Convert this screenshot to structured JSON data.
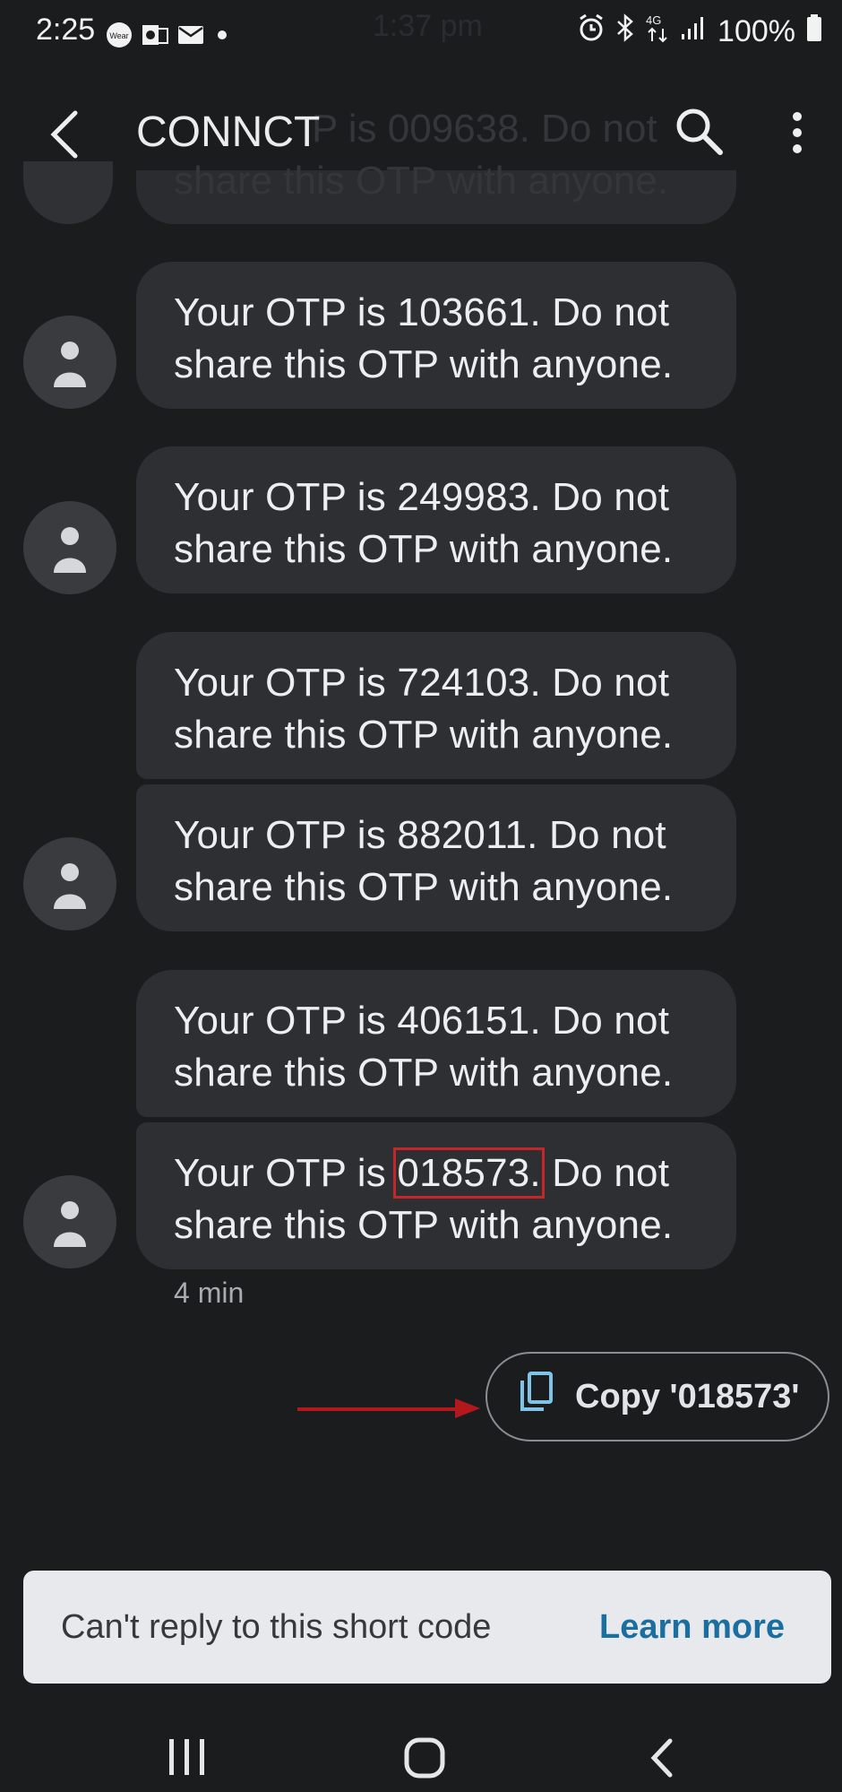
{
  "status_bar": {
    "time": "2:25",
    "left_icons": [
      "wear-os-icon",
      "outlook-icon",
      "mail-icon",
      "dot-icon"
    ],
    "battery_percent": "100%",
    "network": "4G",
    "right_icons": [
      "alarm-icon",
      "bluetooth-icon",
      "network-4g-icon",
      "signal-icon",
      "battery-icon"
    ]
  },
  "ghost": {
    "time": "1:37 pm",
    "message_line1": "P is 009638. Do not",
    "message_line2": "share this OTP with anyone."
  },
  "app_bar": {
    "title": "CONNCT",
    "icons": [
      "back-icon",
      "search-icon",
      "more-vert-icon"
    ]
  },
  "messages": [
    {
      "prefix": "Your OTP is ",
      "otp": "103661",
      "suffix": ". Do not",
      "line2": "share this OTP with anyone."
    },
    {
      "prefix": "Your OTP is ",
      "otp": "249983",
      "suffix": ". Do not",
      "line2": "share this OTP with anyone."
    },
    {
      "prefix": "Your OTP is ",
      "otp": "724103",
      "suffix": ". Do not",
      "line2": "share this OTP with anyone."
    },
    {
      "prefix": "Your OTP is ",
      "otp": "882011",
      "suffix": ". Do not",
      "line2": "share this OTP with anyone."
    },
    {
      "prefix": "Your OTP is ",
      "otp": "406151",
      "suffix": ". Do not",
      "line2": "share this OTP with anyone."
    },
    {
      "prefix": "Your OTP is ",
      "otp": "018573.",
      "suffix": " Do not",
      "line2": "share this OTP with anyone."
    }
  ],
  "timestamp": "4 min",
  "copy_chip": {
    "label": "Copy '018573'",
    "icon": "copy-icon"
  },
  "banner": {
    "text": "Can't reply to this short code",
    "link": "Learn more"
  },
  "colors": {
    "background": "#1b1c1e",
    "bubble": "#2d2f32",
    "highlight": "#c4262a",
    "link": "#1a6fa0",
    "copy_icon": "#7fc3e8"
  },
  "nav_bar": [
    "recent-apps-icon",
    "home-icon",
    "nav-back-icon"
  ]
}
